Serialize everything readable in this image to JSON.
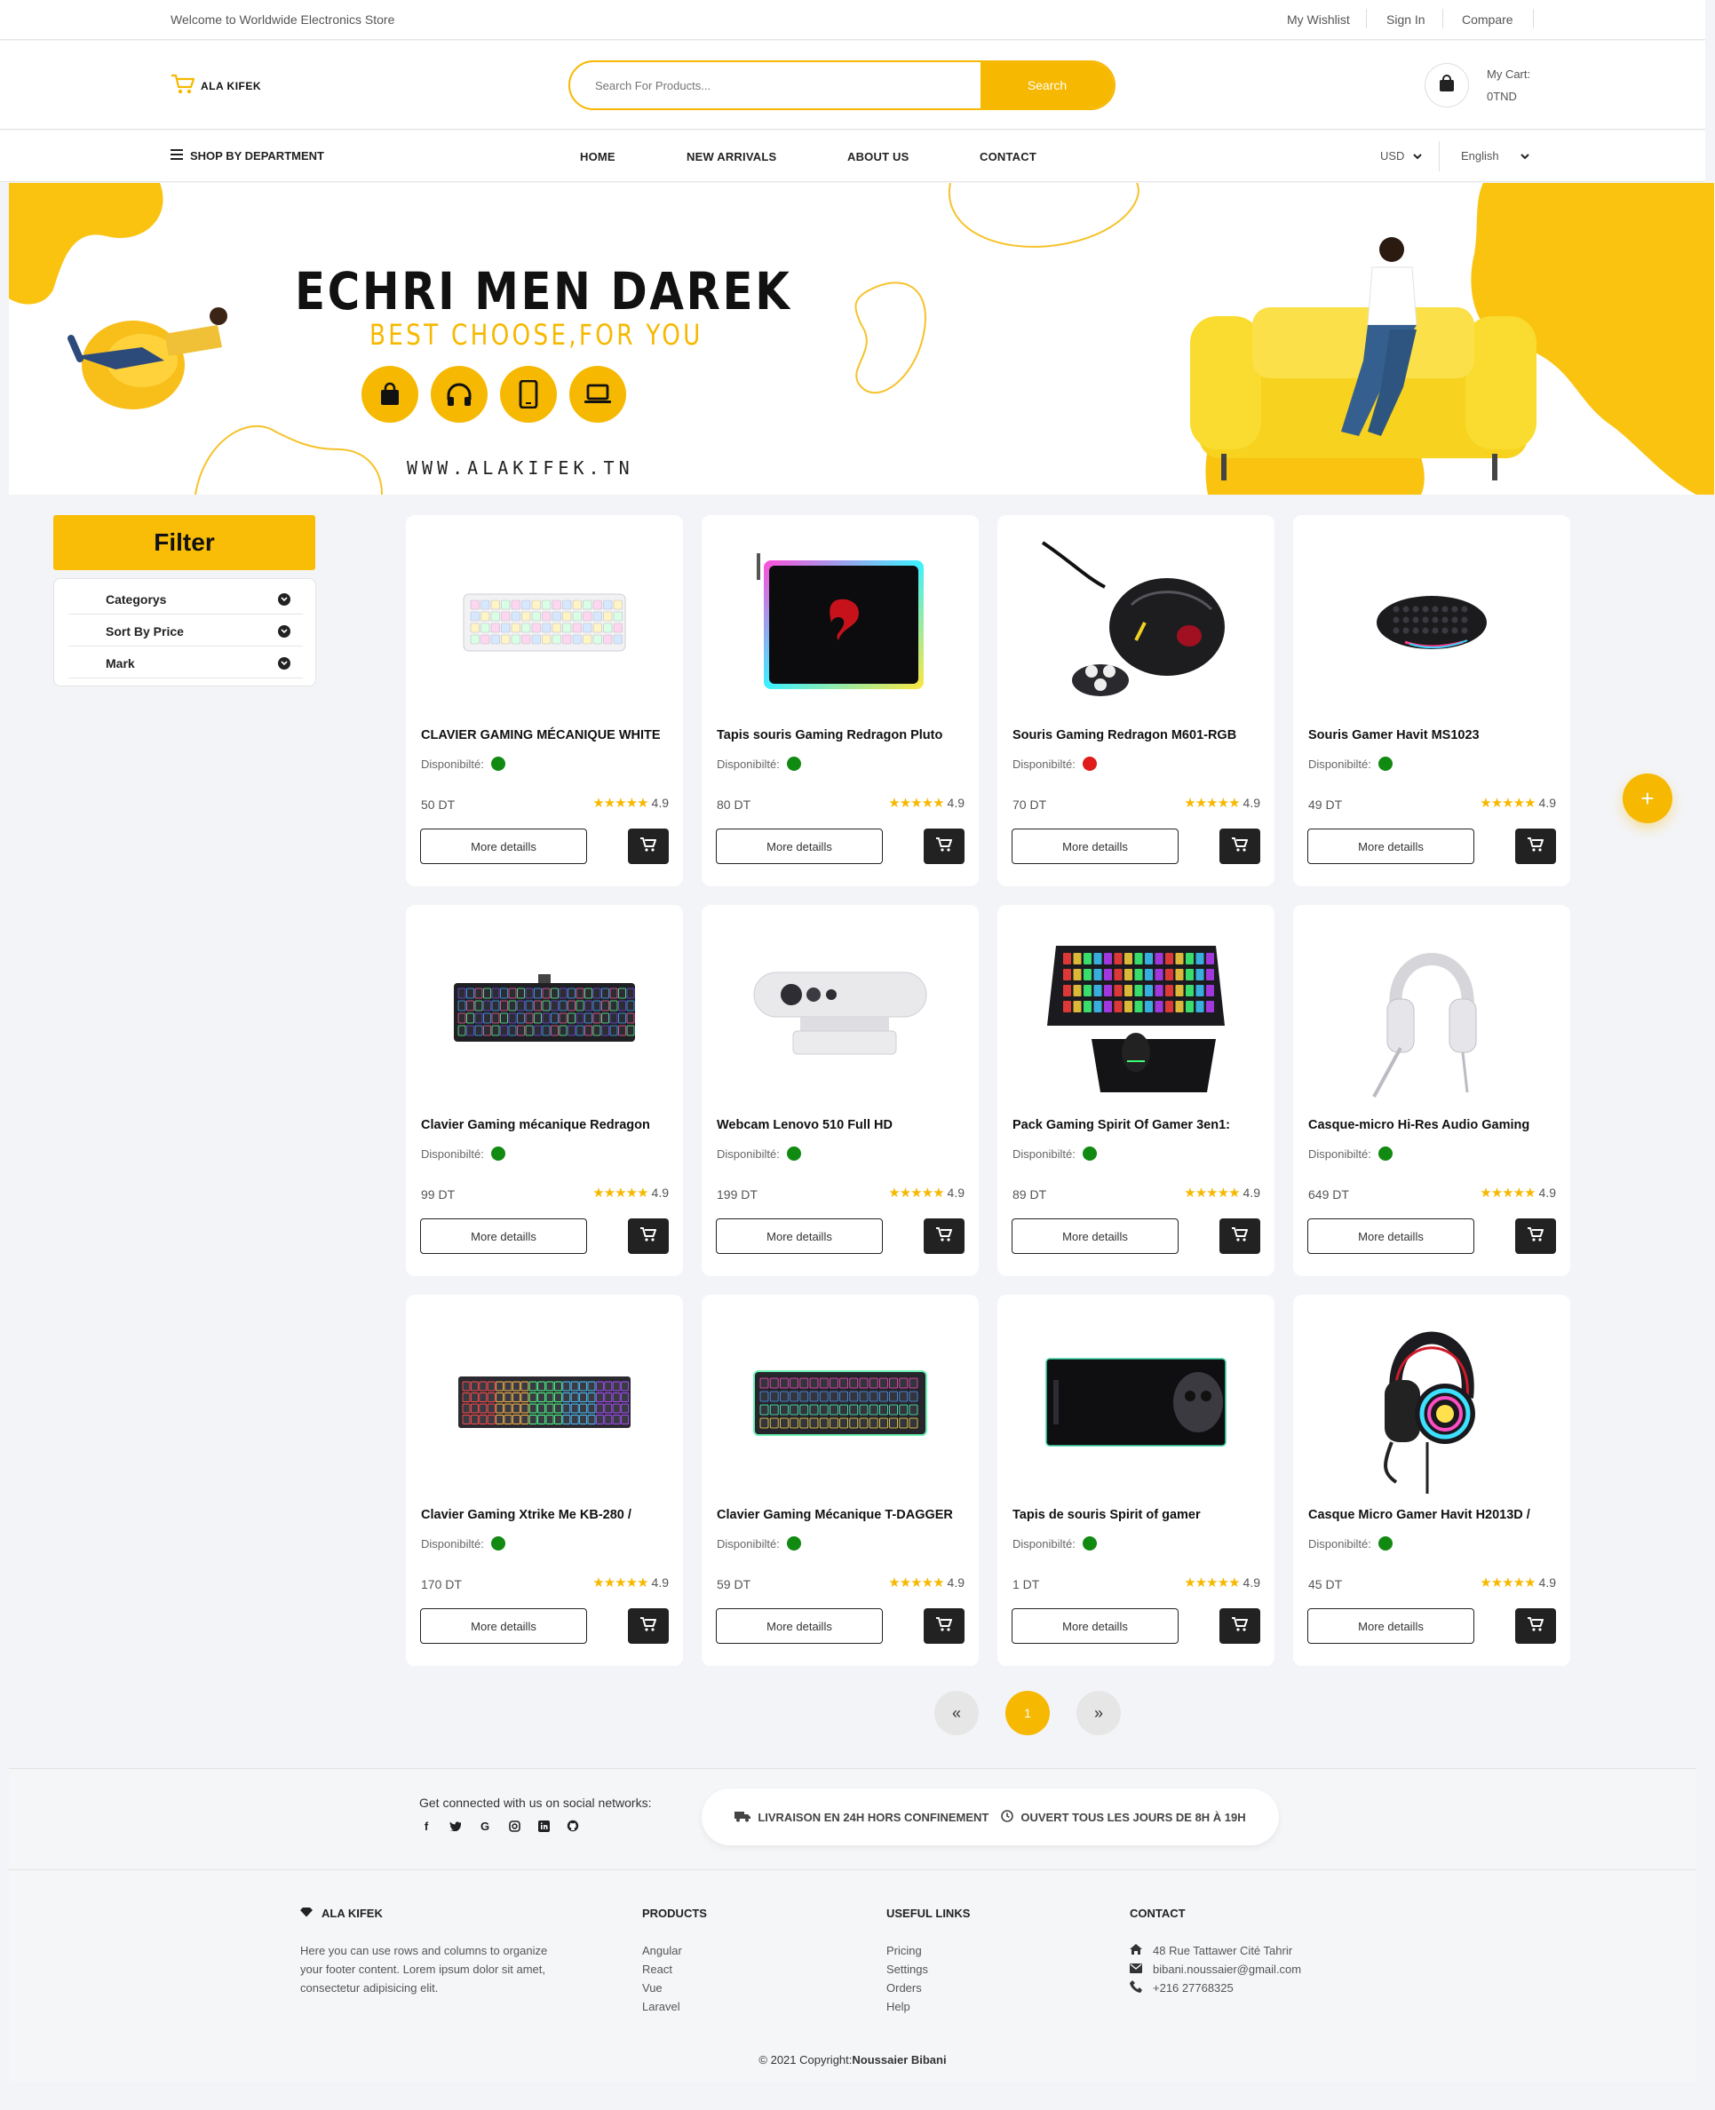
{
  "topbar": {
    "welcome": "Welcome to Worldwide Electronics Store",
    "wishlist": "My Wishlist",
    "signin": "Sign In",
    "compare": "Compare"
  },
  "header": {
    "logo_text": "ALA KIFEK",
    "search_placeholder": "Search For Products...",
    "search_button": "Search",
    "cart_label": "My Cart:",
    "cart_total": "0TND"
  },
  "nav": {
    "department": "SHOP BY DEPARTMENT",
    "links": [
      "HOME",
      "NEW ARRIVALS",
      "ABOUT US",
      "CONTACT"
    ],
    "currency": "USD",
    "language": "English"
  },
  "banner": {
    "title": "ECHRI MEN DAREK",
    "subtitle": "BEST CHOOSE,FOR YOU",
    "url": "WWW.ALAKIFEK.TN"
  },
  "filter": {
    "title": "Filter",
    "options": [
      "Categorys",
      "Sort By Price",
      "Mark"
    ]
  },
  "products": [
    {
      "name": "CLAVIER GAMING MÉCANIQUE WHITE",
      "availability_label": "Disponibilté:",
      "in_stock": true,
      "price": "50 DT",
      "rating": "4.9",
      "more": "More detaills",
      "image": "white-keyboard"
    },
    {
      "name": "Tapis souris Gaming Redragon Pluto",
      "availability_label": "Disponibilté:",
      "in_stock": true,
      "price": "80 DT",
      "rating": "4.9",
      "more": "More detaills",
      "image": "mousepad-rgb"
    },
    {
      "name": "Souris Gaming Redragon M601-RGB",
      "availability_label": "Disponibilté:",
      "in_stock": false,
      "price": "70 DT",
      "rating": "4.9",
      "more": "More detaills",
      "image": "mouse-black"
    },
    {
      "name": "Souris Gamer Havit MS1023",
      "availability_label": "Disponibilté:",
      "in_stock": true,
      "price": "49 DT",
      "rating": "4.9",
      "more": "More detaills",
      "image": "mouse-honeycomb"
    },
    {
      "name": "Clavier Gaming mécanique Redragon",
      "availability_label": "Disponibilté:",
      "in_stock": true,
      "price": "99 DT",
      "rating": "4.9",
      "more": "More detaills",
      "image": "keyboard-dark"
    },
    {
      "name": "Webcam Lenovo 510 Full HD",
      "availability_label": "Disponibilté:",
      "in_stock": true,
      "price": "199 DT",
      "rating": "4.9",
      "more": "More detaills",
      "image": "webcam"
    },
    {
      "name": "Pack Gaming Spirit Of Gamer 3en1:",
      "availability_label": "Disponibilté:",
      "in_stock": true,
      "price": "89 DT",
      "rating": "4.9",
      "more": "More detaills",
      "image": "gaming-pack"
    },
    {
      "name": "Casque-micro Hi-Res Audio Gaming",
      "availability_label": "Disponibilté:",
      "in_stock": true,
      "price": "649 DT",
      "rating": "4.9",
      "more": "More detaills",
      "image": "headset-white"
    },
    {
      "name": "Clavier Gaming Xtrike Me KB-280 /",
      "availability_label": "Disponibilté:",
      "in_stock": true,
      "price": "170 DT",
      "rating": "4.9",
      "more": "More detaills",
      "image": "keyboard-rgb"
    },
    {
      "name": "Clavier Gaming Mécanique T-DAGGER",
      "availability_label": "Disponibilté:",
      "in_stock": true,
      "price": "59 DT",
      "rating": "4.9",
      "more": "More detaills",
      "image": "keyboard-tkl"
    },
    {
      "name": "Tapis de souris Spirit of gamer",
      "availability_label": "Disponibilté:",
      "in_stock": true,
      "price": "1 DT",
      "rating": "4.9",
      "more": "More detaills",
      "image": "mousepad-skull"
    },
    {
      "name": "Casque Micro Gamer Havit H2013D /",
      "availability_label": "Disponibilté:",
      "in_stock": true,
      "price": "45 DT",
      "rating": "4.9",
      "more": "More detaills",
      "image": "headset-black"
    }
  ],
  "pagination": {
    "prev": "«",
    "current": "1",
    "next": "»"
  },
  "fab": "+",
  "footer": {
    "social_title": "Get connected with us on social networks:",
    "social_icons": [
      "facebook-icon",
      "twitter-icon",
      "google-icon",
      "instagram-icon",
      "linkedin-icon",
      "github-icon"
    ],
    "delivery": "LIVRAISON EN 24H HORS CONFINEMENT",
    "hours": "OUVERT TOUS LES JOURS DE 8H À 19H",
    "brand": "ALA KIFEK",
    "brand_text": "Here you can use rows and columns to organize your footer content. Lorem ipsum dolor sit amet, consectetur adipisicing elit.",
    "products_title": "PRODUCTS",
    "products": [
      "Angular",
      "React",
      "Vue",
      "Laravel"
    ],
    "links_title": "USEFUL LINKS",
    "links": [
      "Pricing",
      "Settings",
      "Orders",
      "Help"
    ],
    "contact_title": "CONTACT",
    "address": "48 Rue Tattawer Cité Tahrir",
    "email": "bibani.noussaier@gmail.com",
    "phone": "+216 27768325",
    "copyright_prefix": "© 2021 Copyright:",
    "copyright_name": "Noussaier Bibani"
  },
  "colors": {
    "accent": "#f6b800",
    "in_stock": "#118a11",
    "out_of_stock": "#e01b1b",
    "dark": "#222222"
  }
}
